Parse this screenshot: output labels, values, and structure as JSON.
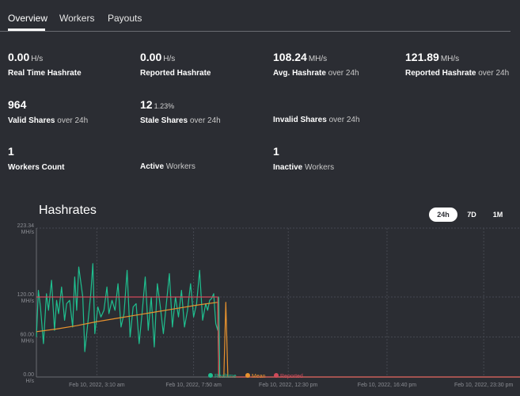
{
  "tabs": [
    {
      "label": "Overview",
      "active": true
    },
    {
      "label": "Workers",
      "active": false
    },
    {
      "label": "Payouts",
      "active": false
    }
  ],
  "stats": {
    "realtime": {
      "value": "0.00",
      "unit": "H/s",
      "label": "Real Time Hashrate",
      "sub": ""
    },
    "reported": {
      "value": "0.00",
      "unit": "H/s",
      "label": "Reported Hashrate",
      "sub": ""
    },
    "avg": {
      "value": "108.24",
      "unit": "MH/s",
      "label": "Avg. Hashrate",
      "sub": "over 24h"
    },
    "reported24": {
      "value": "121.89",
      "unit": "MH/s",
      "label": "Reported Hashrate",
      "sub": "over 24h"
    },
    "valid": {
      "value": "964",
      "unit": "",
      "label": "Valid Shares",
      "sub": "over 24h"
    },
    "stale": {
      "value": "12",
      "unit": "1.23%",
      "label": "Stale Shares",
      "sub": "over 24h"
    },
    "invalid": {
      "value": "",
      "unit": "",
      "label": "Invalid Shares",
      "sub": "over 24h"
    },
    "workers": {
      "value": "1",
      "unit": "",
      "label": "Workers Count",
      "sub": ""
    },
    "active": {
      "value": "",
      "unit": "",
      "label": "Active",
      "sub": "Workers"
    },
    "inactive": {
      "value": "1",
      "unit": "",
      "label": "Inactive",
      "sub": "Workers"
    }
  },
  "chart": {
    "title": "Hashrates",
    "ranges": [
      {
        "label": "24h",
        "active": true
      },
      {
        "label": "7D",
        "active": false
      },
      {
        "label": "1M",
        "active": false
      }
    ]
  },
  "chart_data": {
    "type": "line",
    "title": "Hashrates",
    "ylabel": "",
    "xlabel": "",
    "ylim": [
      0,
      223.34
    ],
    "grid": true,
    "y_ticks": [
      {
        "value": 223.34,
        "label": "223.34",
        "unit": "MH/s"
      },
      {
        "value": 120,
        "label": "120.00",
        "unit": "MH/s"
      },
      {
        "value": 60,
        "label": "60.00",
        "unit": "MH/s"
      },
      {
        "value": 0,
        "label": "0.00",
        "unit": "H/s"
      }
    ],
    "x_ticks": [
      "Feb 10, 2022, 3:10 am",
      "Feb 10, 2022, 7:50 am",
      "Feb 10, 2022, 12:30 pm",
      "Feb 10, 2022, 16:40 pm",
      "Feb 10, 2022, 23:30 pm"
    ],
    "x_range_hours": [
      0,
      24
    ],
    "legend": [
      "Realtime",
      "Mean",
      "Reported"
    ],
    "legend_position": "bottom",
    "series": [
      {
        "name": "Realtime",
        "color": "#1fbf8f",
        "x": [
          0,
          0.1,
          0.2,
          0.35,
          0.5,
          0.6,
          0.75,
          0.9,
          1.0,
          1.1,
          1.25,
          1.4,
          1.5,
          1.65,
          1.8,
          1.9,
          2.0,
          2.1,
          2.3,
          2.4,
          2.55,
          2.7,
          2.8,
          2.9,
          3.05,
          3.2,
          3.35,
          3.5,
          3.6,
          3.75,
          3.9,
          4.05,
          4.2,
          4.35,
          4.5,
          4.65,
          4.8,
          4.95,
          5.1,
          5.25,
          5.4,
          5.55,
          5.7,
          5.85,
          6.0,
          6.15,
          6.3,
          6.45,
          6.6,
          6.75,
          6.9,
          7.05,
          7.2,
          7.35,
          7.5,
          7.65,
          7.8,
          7.95,
          8.1,
          8.25,
          8.4,
          8.5,
          8.6,
          8.7,
          8.8,
          8.9,
          9.0,
          9.05,
          9.1,
          9.15,
          9.3,
          10,
          11,
          12,
          14,
          16,
          18,
          20,
          22,
          24
        ],
        "y": [
          60,
          130,
          105,
          50,
          125,
          100,
          145,
          70,
          115,
          95,
          135,
          85,
          110,
          115,
          75,
          150,
          100,
          165,
          120,
          38,
          80,
          125,
          170,
          65,
          105,
          90,
          100,
          135,
          95,
          115,
          100,
          140,
          75,
          95,
          160,
          60,
          105,
          110,
          50,
          98,
          150,
          70,
          120,
          45,
          140,
          105,
          65,
          110,
          155,
          75,
          120,
          90,
          130,
          75,
          100,
          140,
          90,
          110,
          160,
          85,
          110,
          100,
          115,
          118,
          125,
          80,
          70,
          120,
          0,
          0,
          0,
          0,
          0,
          0,
          0,
          0,
          0,
          0,
          0,
          0
        ]
      },
      {
        "name": "Mean",
        "color": "#e8922e",
        "x": [
          0,
          1,
          2,
          3,
          4,
          5,
          6,
          7,
          8,
          9,
          9.05,
          9.3,
          9.4,
          9.5,
          9.6,
          9.7,
          10,
          12,
          14,
          16,
          18,
          20,
          22,
          24
        ],
        "y": [
          68,
          72,
          77,
          83,
          88,
          93,
          98,
          103,
          108,
          112,
          0,
          0,
          112,
          0,
          0,
          0,
          0,
          0,
          0,
          0,
          0,
          0,
          0,
          0
        ]
      },
      {
        "name": "Reported",
        "color": "#d04a5a",
        "x": [
          0,
          1,
          2,
          3,
          4,
          5,
          6,
          7,
          8,
          9,
          9.05,
          10,
          12,
          14,
          16,
          18,
          20,
          22,
          24
        ],
        "y": [
          120,
          120,
          120,
          120,
          120,
          120,
          120,
          120,
          120,
          120,
          0,
          0,
          0,
          0,
          0,
          0,
          0,
          0,
          0
        ]
      }
    ]
  },
  "colors": {
    "background": "#2b2d33",
    "grid": "#454850",
    "axis_text": "#8a8c92"
  }
}
